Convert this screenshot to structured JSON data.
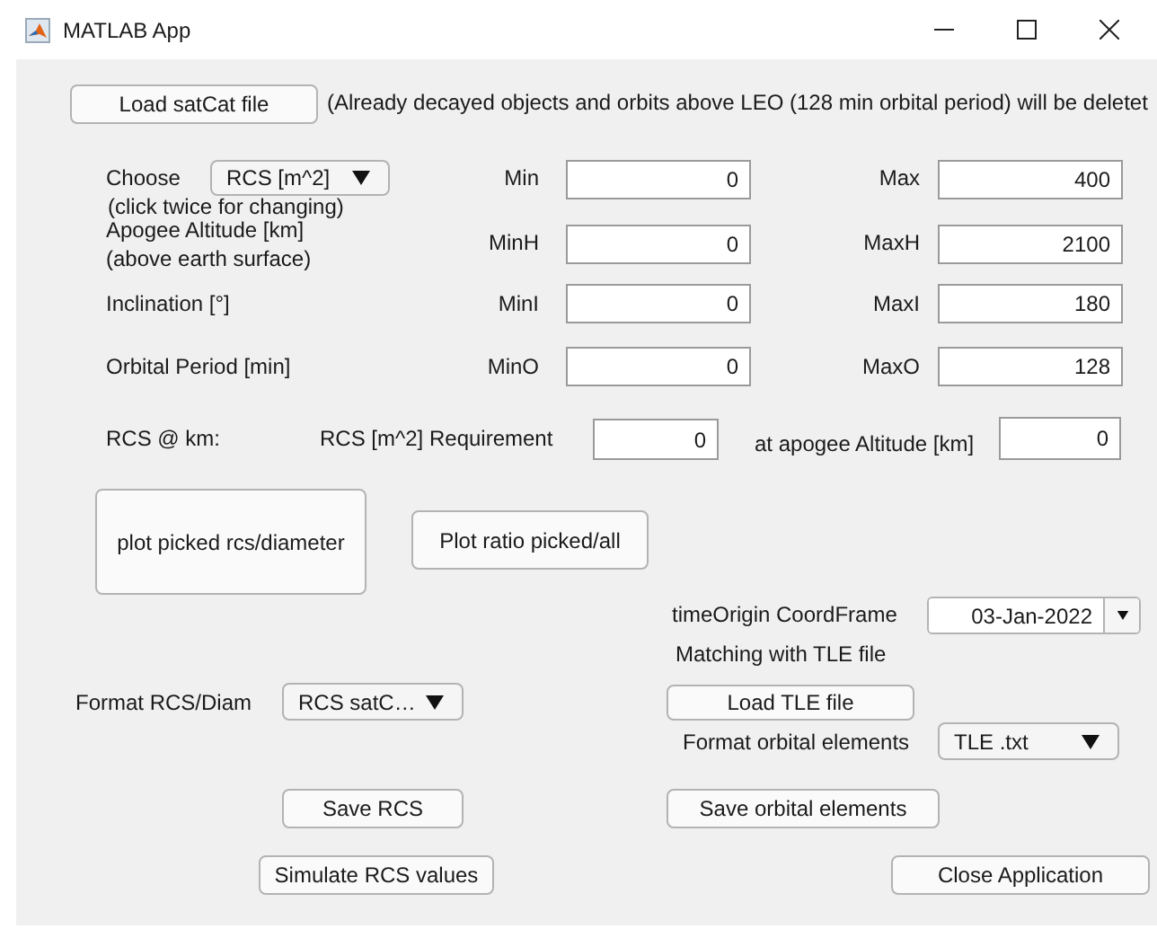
{
  "window": {
    "title": "MATLAB App"
  },
  "controls": [
    {
      "kind": "button",
      "text": "Load satCat file"
    },
    {
      "kind": "label",
      "text": "(Already decayed objects and orbits above LEO (128 min orbital period) will be deletet"
    },
    {
      "kind": "label",
      "text": "Choose"
    },
    {
      "kind": "dropdown",
      "text": "RCS [m^2]"
    },
    {
      "kind": "label",
      "text": "(click twice for changing)"
    },
    {
      "kind": "label",
      "text": "Min"
    },
    {
      "kind": "field",
      "text": "0"
    },
    {
      "kind": "label",
      "text": "Max"
    },
    {
      "kind": "field",
      "text": "400"
    },
    {
      "kind": "label",
      "text": "Apogee Altitude [km]"
    },
    {
      "kind": "label",
      "text": "(above earth surface)"
    },
    {
      "kind": "label",
      "text": "MinH"
    },
    {
      "kind": "field",
      "text": "0"
    },
    {
      "kind": "label",
      "text": "MaxH"
    },
    {
      "kind": "field",
      "text": "2100"
    },
    {
      "kind": "label",
      "text": "Inclination [°]"
    },
    {
      "kind": "label",
      "text": "MinI"
    },
    {
      "kind": "field",
      "text": "0"
    },
    {
      "kind": "label",
      "text": "MaxI"
    },
    {
      "kind": "field",
      "text": "180"
    },
    {
      "kind": "label",
      "text": "Orbital Period [min]"
    },
    {
      "kind": "label",
      "text": "MinO"
    },
    {
      "kind": "field",
      "text": "0"
    },
    {
      "kind": "label",
      "text": "MaxO"
    },
    {
      "kind": "field",
      "text": "128"
    },
    {
      "kind": "label",
      "text": "RCS @ km:"
    },
    {
      "kind": "label",
      "text": "RCS [m^2] Requirement"
    },
    {
      "kind": "field",
      "text": "0"
    },
    {
      "kind": "label",
      "text": "at apogee Altitude [km]"
    },
    {
      "kind": "field",
      "text": "0"
    },
    {
      "kind": "button",
      "text": "plot picked rcs/diameter"
    },
    {
      "kind": "button",
      "text": "Plot ratio picked/all"
    },
    {
      "kind": "label",
      "text": "timeOrigin CoordFrame"
    },
    {
      "kind": "datepicker",
      "text": "03-Jan-2022"
    },
    {
      "kind": "label",
      "text": "Matching with TLE file"
    },
    {
      "kind": "label",
      "text": "Format RCS/Diam"
    },
    {
      "kind": "dropdown",
      "text": "RCS satC…"
    },
    {
      "kind": "button",
      "text": "Load TLE file"
    },
    {
      "kind": "label",
      "text": "Format orbital elements"
    },
    {
      "kind": "dropdown",
      "text": "TLE .txt"
    },
    {
      "kind": "button",
      "text": "Save RCS"
    },
    {
      "kind": "button",
      "text": "Save orbital elements"
    },
    {
      "kind": "button",
      "text": "Simulate RCS values"
    },
    {
      "kind": "button",
      "text": "Close Application"
    }
  ]
}
